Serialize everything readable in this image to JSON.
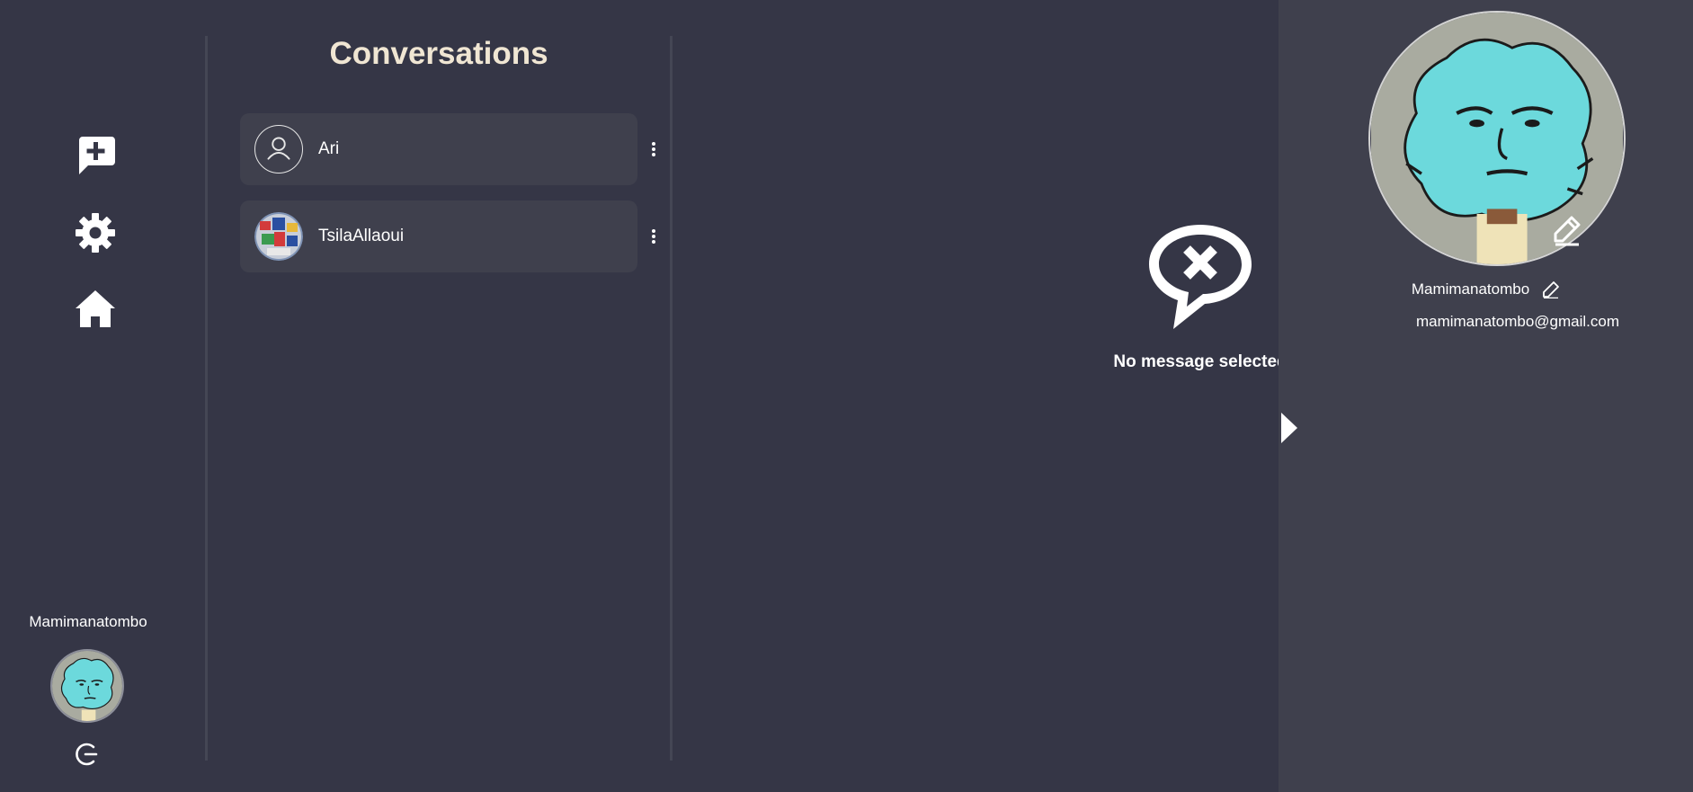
{
  "rail": {
    "username": "Mamimanatombo",
    "buttons": [
      "new-conversation-icon",
      "settings-icon",
      "home-icon"
    ],
    "logout_icon": "logout-icon"
  },
  "conversations": {
    "title": "Conversations",
    "items": [
      {
        "name": "Ari",
        "avatar": "default-user-icon"
      },
      {
        "name": "TsilaAllaoui",
        "avatar": "photo"
      }
    ]
  },
  "empty_state": {
    "icon": "no-message-icon",
    "text": "No message selected"
  },
  "profile": {
    "name": "Mamimanatombo",
    "email": "mamimanatombo@gmail.com"
  },
  "colors": {
    "background": "#353646",
    "panel": "#3f404d",
    "title": "#f0e6d3"
  }
}
